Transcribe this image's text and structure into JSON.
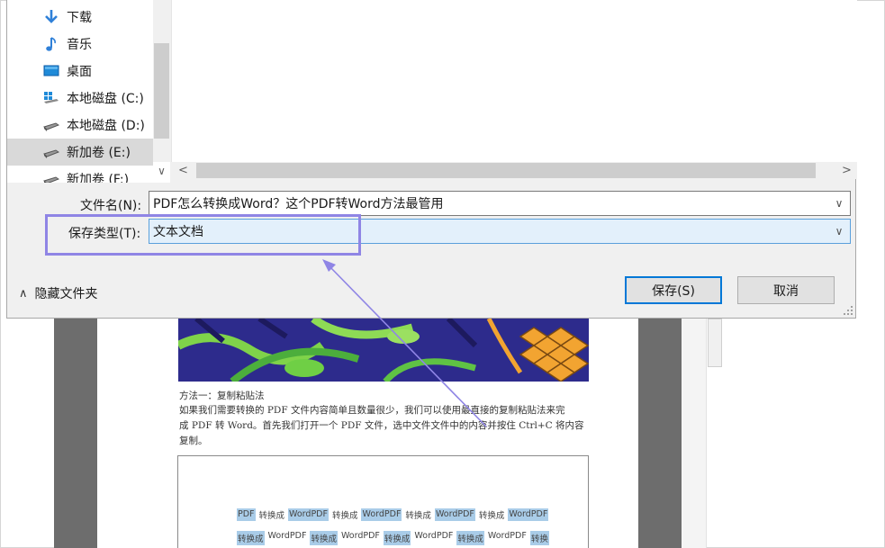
{
  "dialog": {
    "nav_items": [
      {
        "label": "下载",
        "icon": "download-arrow-icon"
      },
      {
        "label": "音乐",
        "icon": "music-note-icon"
      },
      {
        "label": "桌面",
        "icon": "desktop-icon"
      },
      {
        "label": "本地磁盘 (C:)",
        "icon": "windows-drive-icon"
      },
      {
        "label": "本地磁盘 (D:)",
        "icon": "drive-icon"
      },
      {
        "label": "新加卷 (E:)",
        "icon": "drive-icon",
        "selected": true
      },
      {
        "label": "新加卷 (F:)",
        "icon": "drive-icon"
      }
    ],
    "filename_label": "文件名(N):",
    "filename_value": "PDF怎么转换成Word？这个PDF转Word方法最管用",
    "filetype_label": "保存类型(T):",
    "filetype_value": "文本文档",
    "hide_folders_label": "隐藏文件夹",
    "save_label": "保存(S)",
    "cancel_label": "取消",
    "colors": {
      "accent": "#0078d7",
      "annotation": "#8f85e5",
      "selected_field": "#e3f0fb"
    }
  },
  "document": {
    "heading": "方法一：复制粘贴法",
    "paragraph_lines": [
      "如果我们需要转换的 PDF 文件内容简单且数量很少，我们可以使用最直接的复制粘贴法来完",
      "成 PDF 转 Word。首先我们打开一个 PDF 文件，选中文件文件中的内容并按住 Ctrl+C 将内容",
      "复制。"
    ],
    "highlight_line_1": [
      "PDF",
      "转换成",
      "WordPDF",
      "转换成",
      "WordPDF",
      "转换成",
      "WordPDF",
      "转换成",
      "WordPDF"
    ],
    "highlight_line_2": [
      "转换成",
      "WordPDF",
      "转换成",
      "WordPDF",
      "转换成",
      "WordPDF",
      "转换成",
      "WordPDF",
      "转换"
    ]
  }
}
